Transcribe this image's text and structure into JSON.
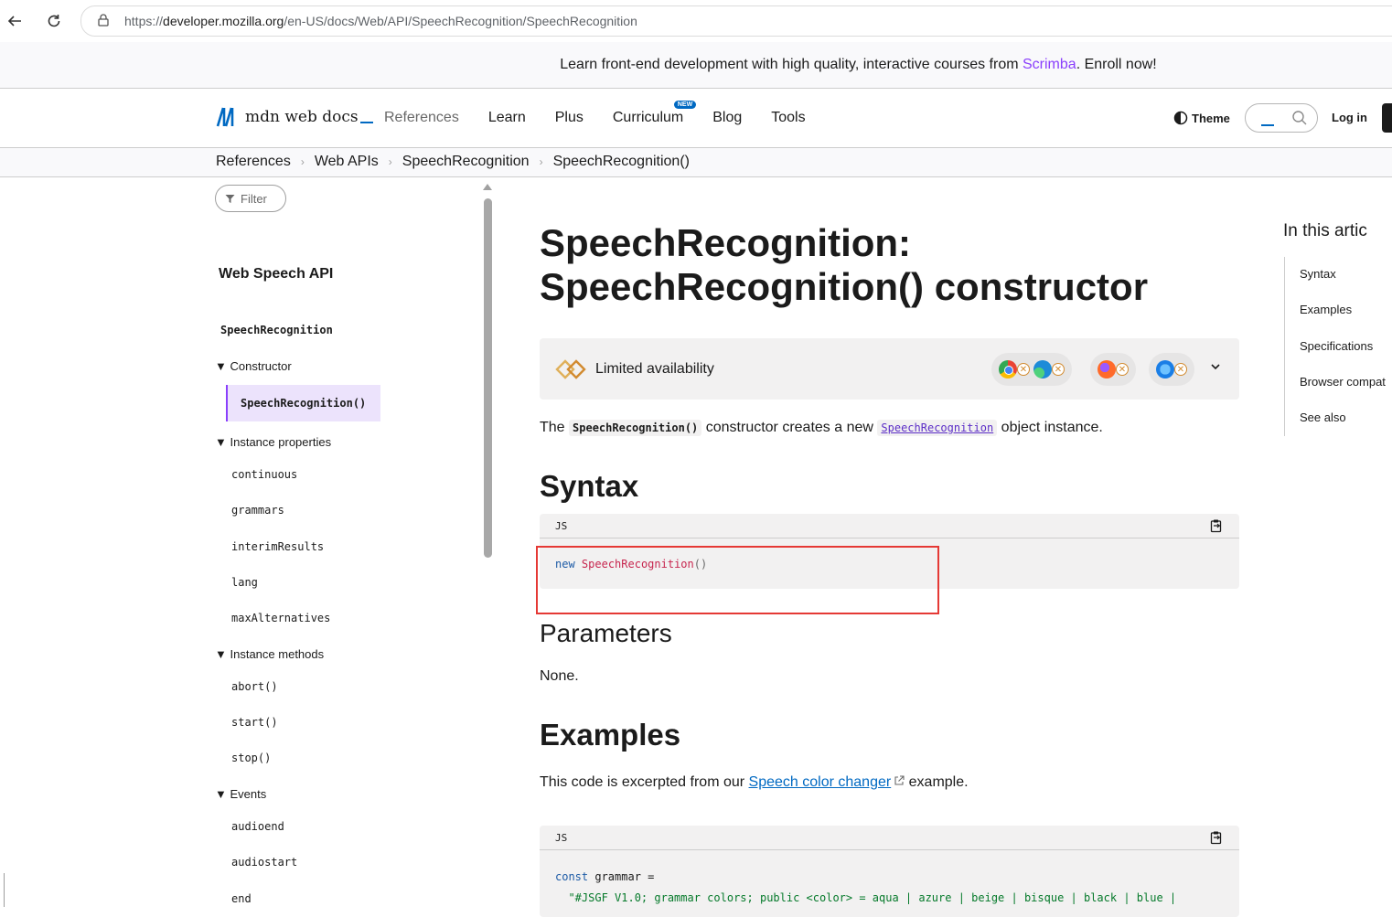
{
  "browser": {
    "url_scheme": "https://",
    "url_host": "developer.mozilla.org",
    "url_path": "/en-US/docs/Web/API/SpeechRecognition/SpeechRecognition"
  },
  "banner": {
    "before": "Learn front-end development with high quality, interactive courses from ",
    "link": "Scrimba",
    "after": ". Enroll now!"
  },
  "header": {
    "logo_text": "mdn web docs",
    "nav": [
      "References",
      "Learn",
      "Plus",
      "Curriculum",
      "Blog",
      "Tools"
    ],
    "new_badge": "NEW",
    "theme_label": "Theme",
    "login_label": "Log in"
  },
  "breadcrumbs": [
    "References",
    "Web APIs",
    "SpeechRecognition",
    "SpeechRecognition()"
  ],
  "sidebar": {
    "filter_label": "Filter",
    "section_title": "Web Speech API",
    "interface": "SpeechRecognition",
    "groups": {
      "constructor": "Constructor",
      "properties": "Instance properties",
      "methods": "Instance methods",
      "events": "Events"
    },
    "constructor_item": "SpeechRecognition()",
    "properties": [
      "continuous",
      "grammars",
      "interimResults",
      "lang",
      "maxAlternatives"
    ],
    "methods": [
      "abort()",
      "start()",
      "stop()"
    ],
    "events": [
      "audioend",
      "audiostart",
      "end"
    ]
  },
  "main": {
    "title_line1": "SpeechRecognition:",
    "title_line2": "SpeechRecognition() constructor",
    "availability": "Limited availability",
    "intro_the": "The ",
    "intro_code": "SpeechRecognition()",
    "intro_mid": " constructor creates a new ",
    "intro_link": "SpeechRecognition",
    "intro_end": " object instance.",
    "syntax_heading": "Syntax",
    "code_lang": "JS",
    "syntax_kw": "new",
    "syntax_fn": "SpeechRecognition",
    "syntax_parens": "()",
    "params_heading": "Parameters",
    "params_text": "None.",
    "examples_heading": "Examples",
    "examples_before": "This code is excerpted from our ",
    "examples_link": "Speech color changer",
    "examples_after": " example.",
    "ex_code_lang": "JS",
    "ex_kw": "const",
    "ex_var": " grammar =",
    "ex_str": "\"#JSGF V1.0; grammar colors; public <color> = aqua | azure | beige | bisque | black | blue |"
  },
  "toc": {
    "title": "In this artic",
    "items": [
      "Syntax",
      "Examples",
      "Specifications",
      "Browser compat",
      "See also"
    ]
  },
  "colors": {
    "accent_purple": "#8a3ffc",
    "link_blue": "#0069c2",
    "highlight_red": "#e53935"
  }
}
